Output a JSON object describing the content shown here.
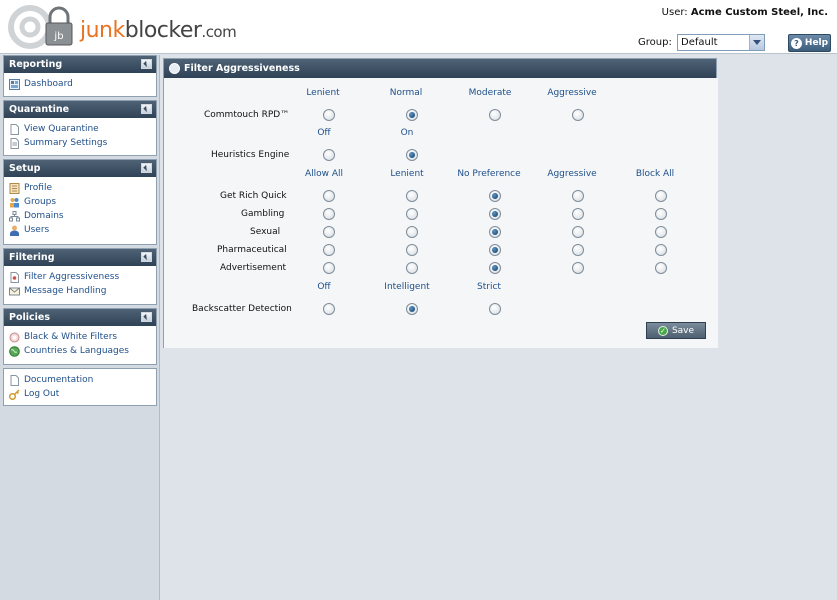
{
  "header": {
    "logo": {
      "junk": "junk",
      "blocker": "blocker",
      "com": ".com"
    },
    "user_label": "User:",
    "user_name": "Acme Custom Steel, Inc.",
    "group_label": "Group:",
    "group_value": "Default",
    "help_label": "Help"
  },
  "sidebar": {
    "reporting": {
      "title": "Reporting",
      "items": [
        "Dashboard"
      ]
    },
    "quarantine": {
      "title": "Quarantine",
      "items": [
        "View Quarantine",
        "Summary Settings"
      ]
    },
    "setup": {
      "title": "Setup",
      "items": [
        "Profile",
        "Groups",
        "Domains",
        "Users"
      ]
    },
    "filtering": {
      "title": "Filtering",
      "items": [
        "Filter Aggressiveness",
        "Message Handling"
      ]
    },
    "policies": {
      "title": "Policies",
      "items": [
        "Black & White Filters",
        "Countries & Languages"
      ]
    },
    "misc": {
      "items": [
        "Documentation",
        "Log Out"
      ]
    }
  },
  "main": {
    "title": "Filter Aggressiveness",
    "commtouch": {
      "label": "Commtouch RPD™",
      "columns": [
        "Lenient",
        "Normal",
        "Moderate",
        "Aggressive"
      ],
      "selected": 1
    },
    "heuristics": {
      "label": "Heuristics Engine",
      "columns": [
        "Off",
        "On"
      ],
      "selected": 1
    },
    "categories": {
      "columns": [
        "Allow All",
        "Lenient",
        "No Preference",
        "Aggressive",
        "Block All"
      ],
      "rows": [
        {
          "label": "Get Rich Quick",
          "selected": 2
        },
        {
          "label": "Gambling",
          "selected": 2
        },
        {
          "label": "Sexual",
          "selected": 2
        },
        {
          "label": "Pharmaceutical",
          "selected": 2
        },
        {
          "label": "Advertisement",
          "selected": 2
        }
      ]
    },
    "backscatter": {
      "label": "Backscatter Detection",
      "columns": [
        "Off",
        "Intelligent",
        "Strict"
      ],
      "selected": 1
    },
    "save_label": "Save"
  },
  "colors": {
    "header_bar": "#2f4256",
    "link": "#1f4f8a",
    "accent_orange": "#e87322"
  }
}
